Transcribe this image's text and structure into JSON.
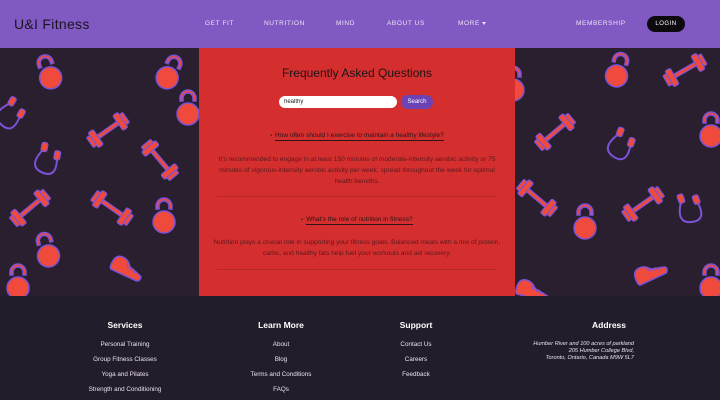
{
  "header": {
    "brand": "U&I Fitness",
    "nav": [
      "GET FIT",
      "NUTRITION",
      "MIND",
      "ABOUT US",
      "MORE"
    ],
    "membership": "MEMBERSHIP",
    "login": "LOGIN"
  },
  "faq": {
    "title": "Frequently Asked Questions",
    "search_value": "healthy",
    "search_button": "Search",
    "items": [
      {
        "question": "How often should I exercise to maintain a healthy lifestyle?",
        "answer": "It's recommended to engage in at least 150 minutes of moderate-intensity aerobic activity or 75 minutes of vigorous-intensity aerobic activity per week, spread throughout the week for optimal health benefits."
      },
      {
        "question": "What's the role of nutrition in fitness?",
        "answer": "Nutrition plays a crucial role in supporting your fitness goals. Balanced meals with a mix of protein, carbs, and healthy fats help fuel your workouts and aid recovery."
      }
    ]
  },
  "footer": {
    "services": {
      "title": "Services",
      "links": [
        "Personal Training",
        "Group Fitness Classes",
        "Yoga and Pilates",
        "Strength and Conditioning"
      ]
    },
    "learn": {
      "title": "Learn More",
      "links": [
        "About",
        "Blog",
        "Terms and Conditions",
        "FAQs"
      ]
    },
    "support": {
      "title": "Support",
      "links": [
        "Contact Us",
        "Careers",
        "Feedback"
      ]
    },
    "address": {
      "title": "Address",
      "lines": [
        "Humber River and 100 acres of parkland",
        "205 Humber College Blvd,",
        "Toronto, Ontario, Canada M9W 5L7"
      ]
    }
  },
  "colors": {
    "header_bg": "#8159c2",
    "faq_bg": "#d42e2e",
    "pattern_bg": "#2a1f2f",
    "icon_fill": "#ef4a3c",
    "icon_outline": "#7b52d8",
    "footer_bg": "#231c2a",
    "search_button": "#6b43b4"
  },
  "icons": [
    "kettlebell-icon",
    "dumbbell-icon",
    "jump-rope-icon",
    "sneaker-icon"
  ]
}
